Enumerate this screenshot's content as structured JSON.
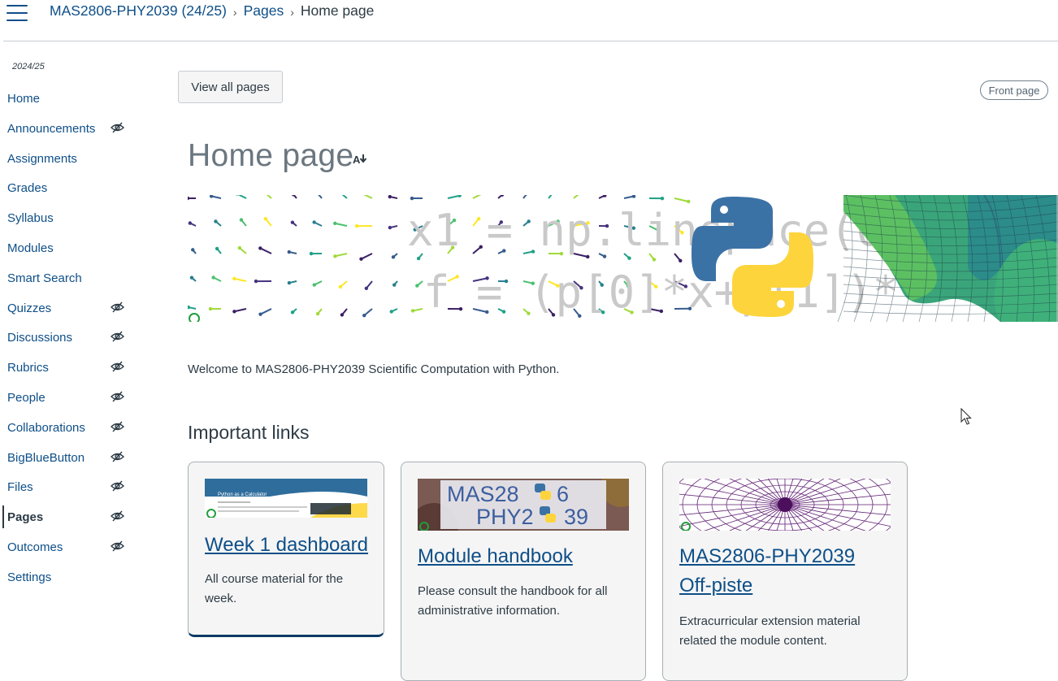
{
  "header": {
    "breadcrumb": [
      {
        "label": "MAS2806-PHY2039 (24/25)"
      },
      {
        "label": "Pages"
      },
      {
        "label": "Home page"
      }
    ]
  },
  "sidebar": {
    "term": "2024/25",
    "items": [
      {
        "label": "Home",
        "hidden_icon": false
      },
      {
        "label": "Announcements",
        "hidden_icon": true
      },
      {
        "label": "Assignments",
        "hidden_icon": false
      },
      {
        "label": "Grades",
        "hidden_icon": false
      },
      {
        "label": "Syllabus",
        "hidden_icon": false
      },
      {
        "label": "Modules",
        "hidden_icon": false
      },
      {
        "label": "Smart Search",
        "hidden_icon": false
      },
      {
        "label": "Quizzes",
        "hidden_icon": true
      },
      {
        "label": "Discussions",
        "hidden_icon": true
      },
      {
        "label": "Rubrics",
        "hidden_icon": true
      },
      {
        "label": "People",
        "hidden_icon": true
      },
      {
        "label": "Collaborations",
        "hidden_icon": true
      },
      {
        "label": "BigBlueButton",
        "hidden_icon": true
      },
      {
        "label": "Files",
        "hidden_icon": true
      },
      {
        "label": "Pages",
        "hidden_icon": true,
        "active": true
      },
      {
        "label": "Outcomes",
        "hidden_icon": true
      },
      {
        "label": "Settings",
        "hidden_icon": false
      }
    ]
  },
  "main": {
    "view_all_label": "View all pages",
    "front_page_badge": "Front page",
    "title": "Home page",
    "banner": {
      "code_line_1": "x1 = np.linspace(0,10",
      "code_line_2": "f = (p[0]*x+p[1])**"
    },
    "welcome": "Welcome to MAS2806-PHY2039 Scientific Computation with Python.",
    "important_links_heading": "Important links",
    "cards": [
      {
        "title": "Week 1 dashboard",
        "desc": "All course material for the week.",
        "thumb_text": "Python as a Calculator"
      },
      {
        "title": "Module handbook",
        "desc": "Please consult the handbook for all administrative information.",
        "thumb_line_1": "MAS28",
        "thumb_line_1b": "6",
        "thumb_line_2": "PHY2",
        "thumb_line_2b": "39"
      },
      {
        "title": "MAS2806-PHY2039 Off-piste",
        "desc": "Extracurricular extension material related the module content."
      }
    ]
  },
  "colors": {
    "link": "#0e4f88",
    "text": "#2d3b45",
    "python_blue": "#3b72a6",
    "python_yellow": "#fed43d"
  }
}
